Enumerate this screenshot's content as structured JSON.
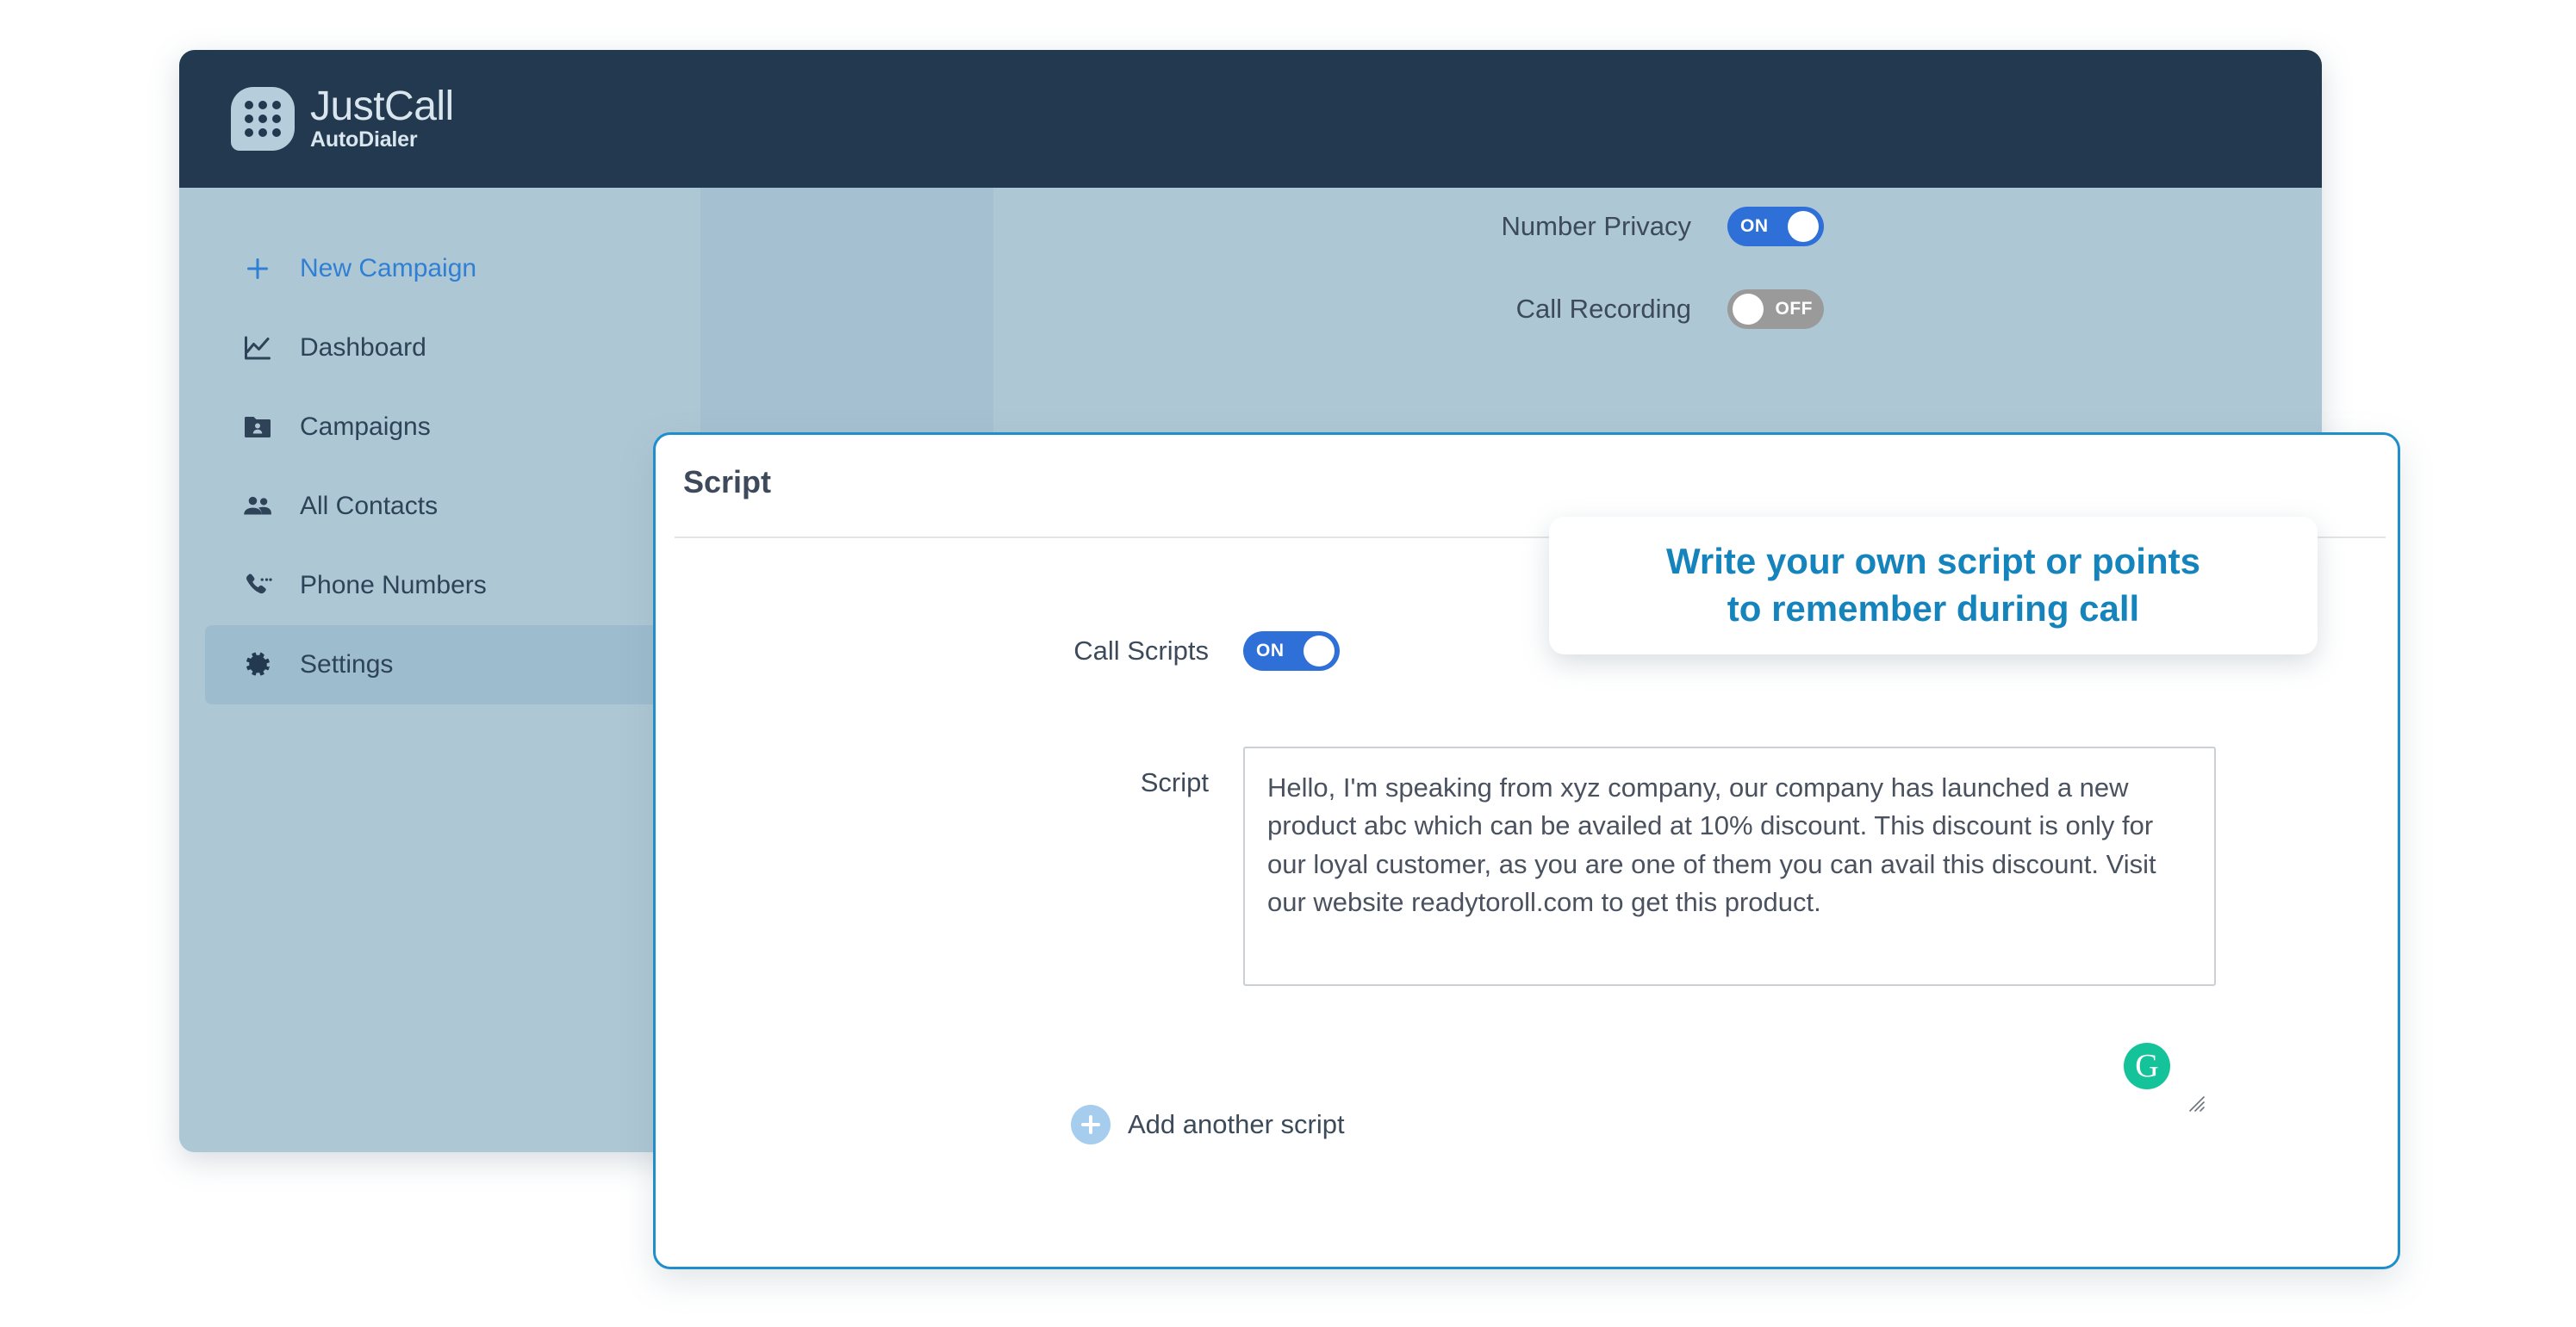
{
  "app": {
    "brand_name": "JustCall",
    "brand_sub": "AutoDialer",
    "logo_icon": "dialpad-grid-icon"
  },
  "sidebar": {
    "items": [
      {
        "label": "New Campaign",
        "icon": "plus-icon",
        "active": false,
        "accent": true
      },
      {
        "label": "Dashboard",
        "icon": "chart-line-icon",
        "active": false,
        "accent": false
      },
      {
        "label": "Campaigns",
        "icon": "folder-user-icon",
        "active": false,
        "accent": false
      },
      {
        "label": "All Contacts",
        "icon": "people-icon",
        "active": false,
        "accent": false
      },
      {
        "label": "Phone Numbers",
        "icon": "phone-icon",
        "active": false,
        "accent": false
      },
      {
        "label": "Settings",
        "icon": "gear-icon",
        "active": true,
        "accent": false
      }
    ]
  },
  "settings": {
    "number_privacy": {
      "label": "Number Privacy",
      "state": "ON"
    },
    "call_recording": {
      "label": "Call Recording",
      "state": "OFF"
    }
  },
  "dialog": {
    "title": "Script",
    "call_scripts": {
      "label": "Call Scripts",
      "state": "ON"
    },
    "script_field": {
      "label": "Script",
      "value": "Hello, I'm speaking from xyz company, our company has launched a new product abc which can be availed at 10% discount. This discount is only for our loyal customer, as you are one of them you can avail this discount. Visit our website readytoroll.com to get this product.",
      "placeholder": "",
      "grammarly_badge": "G"
    },
    "add_script": {
      "label": "Add another script",
      "icon": "plus-circle-icon"
    }
  },
  "callout": {
    "line1": "Write your own script or points",
    "line2": "to remember during call"
  },
  "colors": {
    "header_bg": "#23394f",
    "sidebar_bg": "#aec7d4",
    "toggle_on": "#2f6fd8",
    "toggle_off": "#9a9a9a",
    "dialog_border": "#1f8ecd",
    "callout_text": "#1684bc",
    "accent_link": "#2f7fd4",
    "grammarly_green": "#15c39a"
  }
}
